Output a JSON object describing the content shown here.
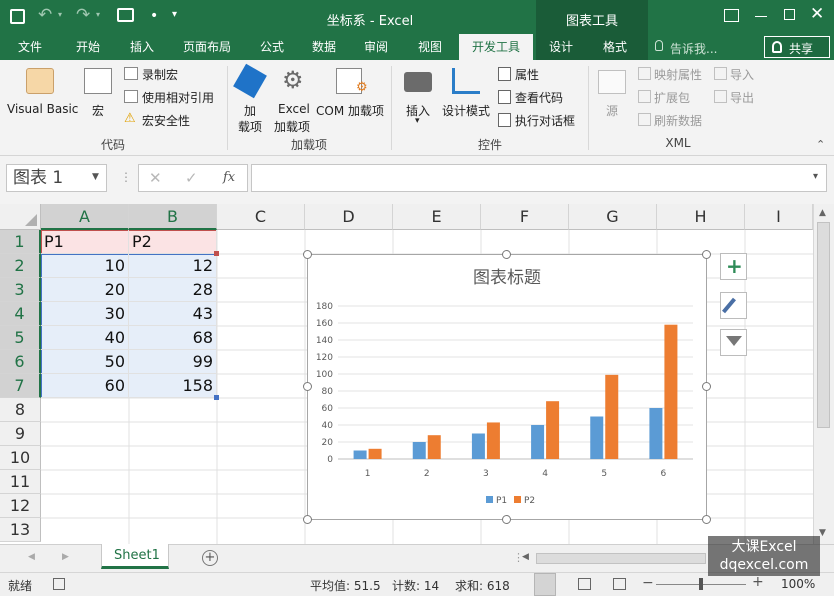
{
  "window": {
    "title": "坐标系 - Excel",
    "context_group": "图表工具"
  },
  "ribbon_tabs": [
    "文件",
    "开始",
    "插入",
    "页面布局",
    "公式",
    "数据",
    "审阅",
    "视图",
    "开发工具",
    "设计",
    "格式"
  ],
  "tell_me": "告诉我...",
  "share": "共享",
  "groups": {
    "code": {
      "label": "代码",
      "visual_basic": "Visual Basic",
      "macros": "宏",
      "record_macro": "录制宏",
      "relative_ref": "使用相对引用",
      "macro_security": "宏安全性"
    },
    "addins": {
      "label": "加载项",
      "addins_l1": "加",
      "addins_l2": "载项",
      "excel_l1": "Excel",
      "excel_l2": "加载项",
      "com": "COM 加载项"
    },
    "controls": {
      "label": "控件",
      "insert": "插入",
      "design_mode": "设计模式",
      "properties": "属性",
      "view_code": "查看代码",
      "run_dialog": "执行对话框"
    },
    "xml": {
      "label": "XML",
      "source": "源",
      "map_props": "映射属性",
      "expansion": "扩展包",
      "refresh": "刷新数据",
      "import": "导入",
      "export": "导出"
    }
  },
  "formula_bar": {
    "name_box": "图表 1",
    "fx": "fx",
    "formula": ""
  },
  "columns": [
    "A",
    "B",
    "C",
    "D",
    "E",
    "F",
    "G",
    "H",
    "I"
  ],
  "rows": [
    "1",
    "2",
    "3",
    "4",
    "5",
    "6",
    "7",
    "8",
    "9",
    "10",
    "11",
    "12",
    "13"
  ],
  "cells": {
    "A1": "P1",
    "B1": "P2",
    "A2": "10",
    "B2": "12",
    "A3": "20",
    "B3": "28",
    "A4": "30",
    "B4": "43",
    "A5": "40",
    "B5": "68",
    "A6": "50",
    "B6": "99",
    "A7": "60",
    "B7": "158"
  },
  "chart_data": {
    "type": "bar",
    "title": "图表标题",
    "categories": [
      "1",
      "2",
      "3",
      "4",
      "5",
      "6"
    ],
    "series": [
      {
        "name": "P1",
        "values": [
          10,
          20,
          30,
          40,
          50,
          60
        ],
        "color": "#5b9bd5"
      },
      {
        "name": "P2",
        "values": [
          12,
          28,
          43,
          68,
          99,
          158
        ],
        "color": "#ed7d31"
      }
    ],
    "yticks": [
      "0",
      "20",
      "40",
      "60",
      "80",
      "100",
      "120",
      "140",
      "160",
      "180"
    ],
    "ylim": [
      0,
      180
    ],
    "legend": "bottom",
    "grid": true
  },
  "sheet": {
    "tab": "Sheet1"
  },
  "status": {
    "ready": "就绪",
    "average": "平均值: 51.5",
    "count": "计数: 14",
    "sum": "求和: 618",
    "zoom": "100%"
  },
  "watermark": {
    "line1": "大课Excel",
    "line2": "dqexcel.com"
  },
  "colors": {
    "excel_green": "#217346",
    "context_green": "#1a5c38",
    "header_highlight": "#fbe3e4",
    "range_highlight": "#e6eef9"
  }
}
